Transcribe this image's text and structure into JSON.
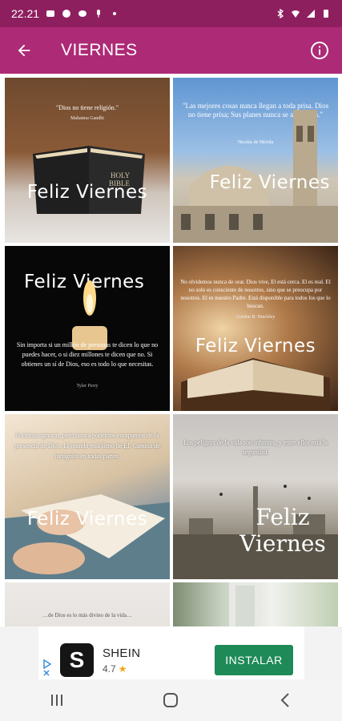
{
  "status_bar": {
    "time": "22.21"
  },
  "app_bar": {
    "title": "VIERNES"
  },
  "tiles": [
    {
      "caption": "\"Dios no tiene religión.\"",
      "author": "Mahatma Gandhi",
      "title": "Feliz Viernes"
    },
    {
      "caption": "\"Las mejores cosas nunca llegan a toda prisa. Dios no tiene prisa; Sus planes nunca se apresuran.\"",
      "author": "Nicolás de Mérida",
      "title": "Feliz Viernes"
    },
    {
      "caption": "Sin importa si un millón de personas te dicen lo que no puedes hacer, o si diez millones te dicen que no. Si obtienes un sí de Dios, eso es todo lo que necesitas.",
      "author": "Tyler Perry",
      "title": "Feliz Viernes"
    },
    {
      "caption": "No olvidemos nunca de orar. Dios vive, El está cerca. El es real. El no solo es consciente de nosotros, sino que se preocupa por nosotros. El es nuestro Padre. Está disponible para todos los que lo buscan.",
      "author": "Gordon B. Hinckley",
      "title": "Feliz Viernes"
    },
    {
      "caption": "Podemos ignorar, pero nunca podemos escaparnos de la presencia de Dios. El mundo está lleno de El. Camina de incógnito en todas partes.",
      "author": "",
      "title": "Feliz Viernes"
    },
    {
      "caption": "Los peligros de la vida son infinitos, y entre ellos está la seguridad.",
      "author": "",
      "title": "Feliz Viernes"
    },
    {
      "caption": "…de Dios es lo más divino de la vida…",
      "author": "",
      "title": ""
    },
    {
      "caption": "",
      "author": "",
      "title": ""
    }
  ],
  "ad": {
    "app_name": "SHEIN",
    "logo_letter": "S",
    "rating": "4.7",
    "star": "★",
    "install_label": "INSTALAR"
  },
  "colors": {
    "status_bar": "#8e1f5f",
    "app_bar": "#ad2a76",
    "install_button": "#1e8a57"
  }
}
